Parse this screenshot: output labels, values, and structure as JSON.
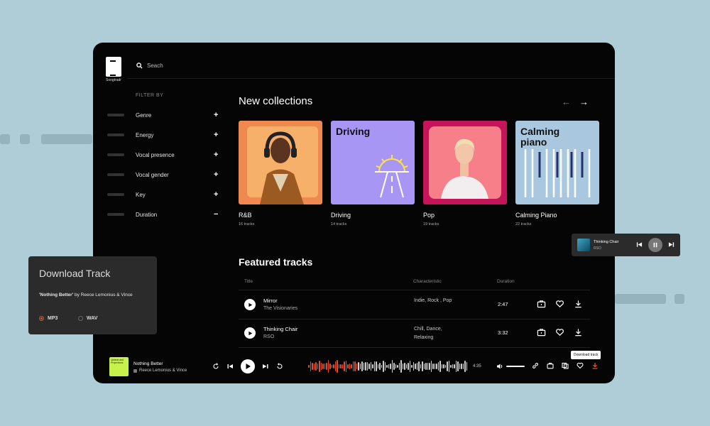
{
  "brand": {
    "name": "Songtradr"
  },
  "search": {
    "placeholder": "Seach"
  },
  "sidebar": {
    "filter_label": "FILTER BY",
    "filters": [
      {
        "label": "Genre",
        "state": "+"
      },
      {
        "label": "Energy",
        "state": "+"
      },
      {
        "label": "Vocal presence",
        "state": "+"
      },
      {
        "label": "Vocal gender",
        "state": "+"
      },
      {
        "label": "Key",
        "state": "+"
      },
      {
        "label": "Duration",
        "state": "−"
      }
    ]
  },
  "collections": {
    "heading": "New collections",
    "prev_icon": "arrow-left-icon",
    "next_icon": "arrow-right-icon",
    "items": [
      {
        "title": "R&B",
        "count": "16 tracks",
        "color": "#f0894f",
        "overlay": ""
      },
      {
        "title": "Driving",
        "count": "14 tracks",
        "color": "#a896f5",
        "overlay": "Driving"
      },
      {
        "title": "Pop",
        "count": "19 tracks",
        "color": "#f06478",
        "overlay": ""
      },
      {
        "title": "Calming Piano",
        "count": "22 tracks",
        "color": "#a9c8df",
        "overlay": "Calming piano"
      }
    ]
  },
  "featured": {
    "heading": "Featured tracks",
    "columns": {
      "title": "Title",
      "characteristic": "Characteristic",
      "duration": "Duration"
    },
    "tracks": [
      {
        "name": "Mirror",
        "artist": "The Visionaries",
        "characteristic": "Indie, Rock , Pop",
        "duration": "2:47"
      },
      {
        "name": "Thinking Chair",
        "artist": "RSO",
        "characteristic": "Chill, Dance, Relaxing",
        "duration": "3:32"
      }
    ]
  },
  "player": {
    "art_text": "Upbeat and Projections",
    "title": "Nothing Better",
    "artist": "Reece Lemonius & Vince",
    "time": "4:35",
    "tooltip": "Download track",
    "accent": "#e0502a"
  },
  "download_panel": {
    "title": "Download Track",
    "song": "'Nothing Better'",
    "by": " by Reece Lemonius & Vince",
    "options": [
      "MP3",
      "WAV"
    ],
    "selected": "MP3"
  },
  "mini_player": {
    "title": "Thinking Chair",
    "artist": "RSO"
  }
}
